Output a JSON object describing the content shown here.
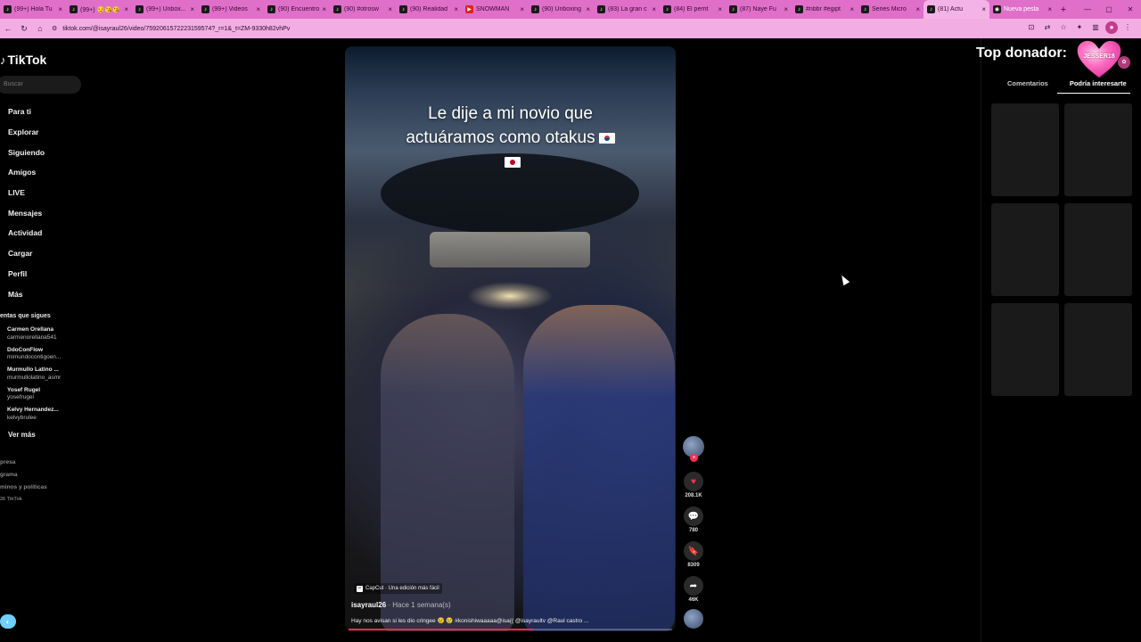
{
  "browser": {
    "tabs": [
      {
        "label": "(99+) Hola Tu",
        "icon": "tiktok-icon"
      },
      {
        "label": "(99+) 😏😘😘",
        "icon": "tiktok-icon"
      },
      {
        "label": "(99+) Unbox...",
        "icon": "tiktok-icon"
      },
      {
        "label": "(99+) Videos",
        "icon": "tiktok-icon"
      },
      {
        "label": "(90) Encuentro",
        "icon": "tiktok-icon"
      },
      {
        "label": "(90) #otrosw",
        "icon": "tiktok-icon"
      },
      {
        "label": "(90) Realidad",
        "icon": "tiktok-icon"
      },
      {
        "label": "SNOWMAN",
        "icon": "youtube-icon"
      },
      {
        "label": "(90) Unboxing",
        "icon": "tiktok-icon"
      },
      {
        "label": "(83) La gran c",
        "icon": "tiktok-icon"
      },
      {
        "label": "(84) El perrit",
        "icon": "tiktok-icon"
      },
      {
        "label": "(87) Naye Fu",
        "icon": "tiktok-icon"
      },
      {
        "label": "#nbbr #egipt",
        "icon": "tiktok-icon"
      },
      {
        "label": "Series Micro",
        "icon": "tiktok-icon"
      },
      {
        "label": "(81) Actu",
        "icon": "tiktok-icon",
        "active": true
      },
      {
        "label": "Nueva pesta",
        "icon": "newtab-icon"
      }
    ],
    "url": "tiktok.com/@isayraul26/video/7592061572223159574?_r=1&_t=ZM-9330h82vhPv"
  },
  "sidebar": {
    "logo": "TikTok",
    "search_placeholder": "Buscar",
    "nav": [
      {
        "label": "Para ti",
        "icon": "home-icon"
      },
      {
        "label": "Explorar",
        "icon": "compass-icon"
      },
      {
        "label": "Siguiendo",
        "icon": "following-icon"
      },
      {
        "label": "Amigos",
        "icon": "friends-icon"
      },
      {
        "label": "LIVE",
        "icon": "live-icon"
      },
      {
        "label": "Mensajes",
        "icon": "messages-icon"
      },
      {
        "label": "Actividad",
        "icon": "activity-icon"
      },
      {
        "label": "Cargar",
        "icon": "upload-icon"
      },
      {
        "label": "Perfil",
        "icon": "profile-icon"
      },
      {
        "label": "Más",
        "icon": "more-icon"
      }
    ],
    "following_title": "entas que sigues",
    "following": [
      {
        "name": "Carmen Orellana",
        "user": "carmenorellana541"
      },
      {
        "name": "DdoConFlow",
        "user": "mimundocontigoen..."
      },
      {
        "name": "Murmullo Latino ...",
        "user": "murmullolatino_asmr"
      },
      {
        "name": "Yosef Rugel",
        "user": "yosefrugel"
      },
      {
        "name": "Kelvy Hernandez...",
        "user": "kelvybrulee"
      }
    ],
    "see_more": "Ver más",
    "footer": [
      "presa",
      "grama",
      "minos y políticas"
    ],
    "copyright": "26 TikTok"
  },
  "video": {
    "caption_line1": "Le dije a mi novio que",
    "caption_line2": "actuáramos como otakus",
    "capcut_label": "CapCut · Una edición más fácil",
    "author": "isayraul26",
    "posted": "· Hace 1 semana(s)",
    "description": "Hay nos avisan si les dio cringee 😢 😢 #konishiwaaaaa@isa(( @isayraultv @Raul castro ...",
    "progress": 0.57
  },
  "actions": {
    "likes": "208.1K",
    "comments": "780",
    "saves": "8309",
    "shares": "46K"
  },
  "right_panel": {
    "donor_label": "Top donador:",
    "donor_name": "JESSER18",
    "tabs": [
      "Comentarios",
      "Podría interesarte"
    ],
    "active_tab": "Podría interesarte",
    "thumbnails": 6
  }
}
